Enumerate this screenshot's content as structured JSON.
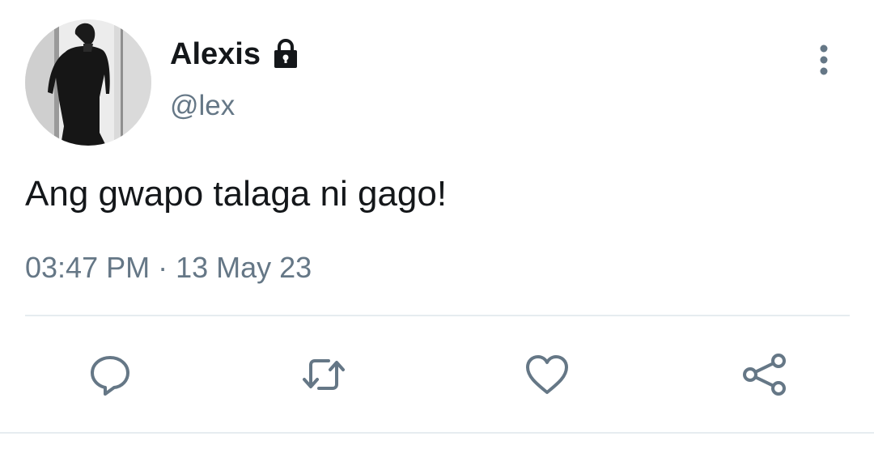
{
  "tweet": {
    "display_name": "Alexis",
    "handle": "@lex",
    "text": "Ang gwapo talaga ni gago!",
    "time": "03:47 PM",
    "separator": " · ",
    "date": "13 May 23",
    "protected": true
  },
  "icons": {
    "lock": "lock-icon",
    "more": "more-vertical-icon",
    "reply": "reply-icon",
    "retweet": "retweet-icon",
    "like": "heart-icon",
    "share": "share-icon"
  },
  "colors": {
    "text_primary": "#14171a",
    "text_secondary": "#657786",
    "icon": "#657786",
    "divider": "#e6ecf0"
  }
}
